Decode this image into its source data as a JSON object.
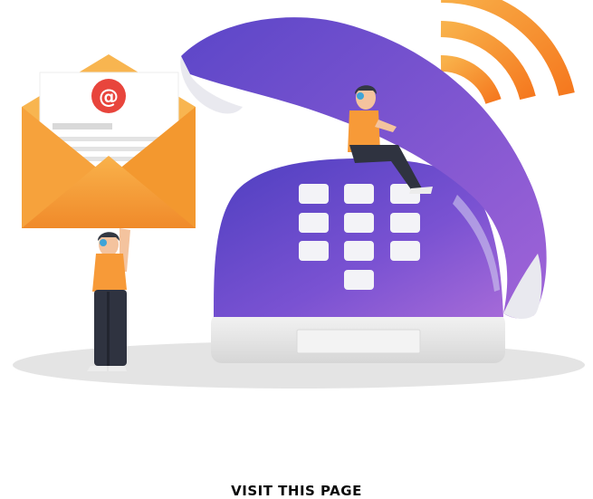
{
  "email_card": {
    "at_symbol": "@"
  },
  "cta": {
    "label": "VISIT THIS PAGE"
  },
  "colors": {
    "phone_purple": "#7b4fd6",
    "phone_purple_light": "#9b6be0",
    "envelope_orange": "#f7a23a",
    "wave_orange": "#f99a2e",
    "at_red": "#e8453c",
    "shadow_gray": "#e6e6e6"
  },
  "icons": [
    "envelope-icon",
    "at-sign-icon",
    "telephone-icon",
    "signal-waves-icon"
  ]
}
